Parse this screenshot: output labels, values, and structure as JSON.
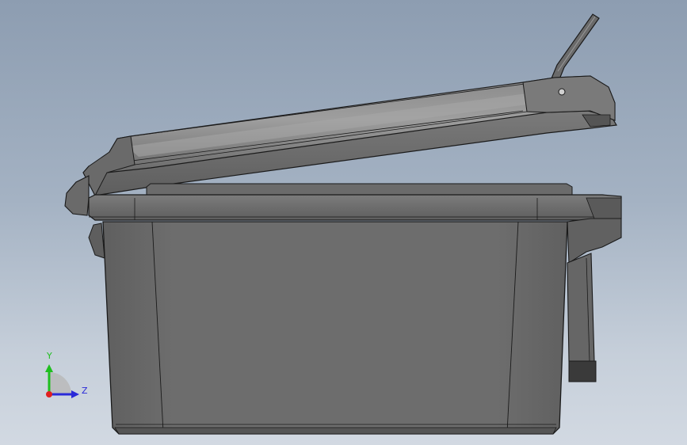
{
  "viewport": {
    "background_top": "#8d9db1",
    "background_bottom": "#d2d9e2"
  },
  "model": {
    "part_colors": {
      "body": "#6e6e6e",
      "body_dark": "#5a5a5a",
      "edge": "#1a1a1a",
      "highlight": "#9a9a9a"
    }
  },
  "triad": {
    "y_label": "Y",
    "z_label": "Z",
    "colors": {
      "y": "#1fbf1f",
      "z": "#2a2ad8",
      "origin": "#e02020"
    }
  }
}
